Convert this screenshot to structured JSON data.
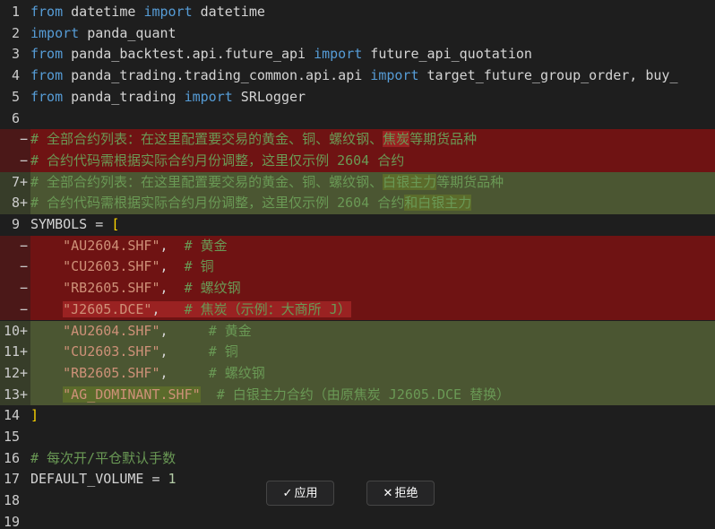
{
  "editor": {
    "lines": [
      {
        "num": "1",
        "mark": "",
        "kind": "normal",
        "segs": [
          [
            "kw",
            "from"
          ],
          [
            "id",
            " datetime "
          ],
          [
            "kw",
            "import"
          ],
          [
            "id",
            " datetime"
          ]
        ]
      },
      {
        "num": "2",
        "mark": "",
        "kind": "normal",
        "segs": [
          [
            "kw",
            "import"
          ],
          [
            "id",
            " panda_quant"
          ]
        ]
      },
      {
        "num": "3",
        "mark": "",
        "kind": "normal",
        "segs": [
          [
            "kw",
            "from"
          ],
          [
            "id",
            " panda_backtest.api.future_api "
          ],
          [
            "kw",
            "import"
          ],
          [
            "id",
            " future_api_quotation"
          ]
        ]
      },
      {
        "num": "4",
        "mark": "",
        "kind": "normal",
        "segs": [
          [
            "kw",
            "from"
          ],
          [
            "id",
            " panda_trading.trading_common.api.api "
          ],
          [
            "kw",
            "import"
          ],
          [
            "id",
            " target_future_group_order, buy_"
          ]
        ]
      },
      {
        "num": "5",
        "mark": "",
        "kind": "normal",
        "segs": [
          [
            "kw",
            "from"
          ],
          [
            "id",
            " panda_trading "
          ],
          [
            "kw",
            "import"
          ],
          [
            "id",
            " SRLogger"
          ]
        ]
      },
      {
        "num": "6",
        "mark": "",
        "kind": "normal",
        "segs": []
      },
      {
        "num": "",
        "mark": "−",
        "kind": "removed",
        "segs": [
          [
            "cmt",
            "# 全部合约列表：在这里配置要交易的黄金、铜、螺纹钢、"
          ],
          [
            "cmt hl-removed",
            "焦炭"
          ],
          [
            "cmt",
            "等期货品种"
          ]
        ]
      },
      {
        "num": "",
        "mark": "−",
        "kind": "removed",
        "segs": [
          [
            "cmt",
            "# 合约代码需根据实际合约月份调整，这里仅示例 2604 合约"
          ]
        ]
      },
      {
        "num": "7",
        "mark": "+",
        "kind": "added",
        "segs": [
          [
            "cmt",
            "# 全部合约列表：在这里配置要交易的黄金、铜、螺纹钢、"
          ],
          [
            "cmt hl-added",
            "白银主力"
          ],
          [
            "cmt",
            "等期货品种"
          ]
        ]
      },
      {
        "num": "8",
        "mark": "+",
        "kind": "added",
        "segs": [
          [
            "cmt",
            "# 合约代码需根据实际合约月份调整，这里仅示例 2604 合约"
          ],
          [
            "cmt hl-added",
            "和白银主力"
          ]
        ]
      },
      {
        "num": "9",
        "mark": "",
        "kind": "normal",
        "segs": [
          [
            "id",
            "SYMBOLS = "
          ],
          [
            "brk",
            "["
          ]
        ]
      },
      {
        "num": "",
        "mark": "−",
        "kind": "removed",
        "segs": [
          [
            "id",
            "    "
          ],
          [
            "str",
            "\"AU2604.SHF\""
          ],
          [
            "id",
            ",  "
          ],
          [
            "cmt",
            "# 黄金"
          ]
        ]
      },
      {
        "num": "",
        "mark": "−",
        "kind": "removed",
        "segs": [
          [
            "id",
            "    "
          ],
          [
            "str",
            "\"CU2603.SHF\""
          ],
          [
            "id",
            ",  "
          ],
          [
            "cmt",
            "# 铜"
          ]
        ]
      },
      {
        "num": "",
        "mark": "−",
        "kind": "removed",
        "segs": [
          [
            "id",
            "    "
          ],
          [
            "str",
            "\"RB2605.SHF\""
          ],
          [
            "id",
            ",  "
          ],
          [
            "cmt",
            "# 螺纹钢"
          ]
        ]
      },
      {
        "num": "",
        "mark": "−",
        "kind": "removed",
        "segs": [
          [
            "id",
            "    "
          ],
          [
            "str hl-removed",
            "\"J2605.DCE\""
          ],
          [
            "id hl-removed",
            ",   "
          ],
          [
            "cmt hl-removed",
            "# 焦炭（示例：大商所 J）"
          ]
        ]
      },
      {
        "num": "10",
        "mark": "+",
        "kind": "added",
        "segs": [
          [
            "id",
            "    "
          ],
          [
            "str",
            "\"AU2604.SHF\""
          ],
          [
            "id",
            ",     "
          ],
          [
            "cmt",
            "# 黄金"
          ]
        ]
      },
      {
        "num": "11",
        "mark": "+",
        "kind": "added",
        "segs": [
          [
            "id",
            "    "
          ],
          [
            "str",
            "\"CU2603.SHF\""
          ],
          [
            "id",
            ",     "
          ],
          [
            "cmt",
            "# 铜"
          ]
        ]
      },
      {
        "num": "12",
        "mark": "+",
        "kind": "added",
        "segs": [
          [
            "id",
            "    "
          ],
          [
            "str",
            "\"RB2605.SHF\""
          ],
          [
            "id",
            ",     "
          ],
          [
            "cmt",
            "# 螺纹钢"
          ]
        ]
      },
      {
        "num": "13",
        "mark": "+",
        "kind": "added",
        "segs": [
          [
            "id",
            "    "
          ],
          [
            "str hl-added",
            "\"AG_DOMINANT.SHF\""
          ],
          [
            "id",
            "  "
          ],
          [
            "cmt",
            "# 白银主力合约（由原焦炭 J2605.DCE 替换）"
          ]
        ]
      },
      {
        "num": "14",
        "mark": "",
        "kind": "normal",
        "segs": [
          [
            "brk",
            "]"
          ]
        ]
      },
      {
        "num": "15",
        "mark": "",
        "kind": "normal",
        "segs": []
      },
      {
        "num": "16",
        "mark": "",
        "kind": "normal",
        "segs": [
          [
            "cmt",
            "# 每次开/平仓默认手数"
          ]
        ]
      },
      {
        "num": "17",
        "mark": "",
        "kind": "normal",
        "segs": [
          [
            "id",
            "DEFAULT_VOLUME = "
          ],
          [
            "num-lit",
            "1"
          ]
        ]
      },
      {
        "num": "18",
        "mark": "",
        "kind": "normal",
        "segs": []
      },
      {
        "num": "19",
        "mark": "",
        "kind": "normal",
        "segs": []
      }
    ]
  },
  "actions": {
    "apply_icon": "✓",
    "apply_label": "应用",
    "reject_icon": "✕",
    "reject_label": "拒绝"
  },
  "icons": {
    "apply": "check-icon",
    "reject": "close-icon"
  },
  "colors": {
    "background": "#1e1e1e",
    "removed_line": "#6f1313",
    "removed_highlight": "#9a2222",
    "added_line": "#4b5632",
    "added_highlight": "#5b6b2b",
    "keyword": "#569cd6",
    "string": "#ce9178",
    "comment": "#6a9955",
    "number": "#b5cea8",
    "bracket": "#ffd700"
  }
}
